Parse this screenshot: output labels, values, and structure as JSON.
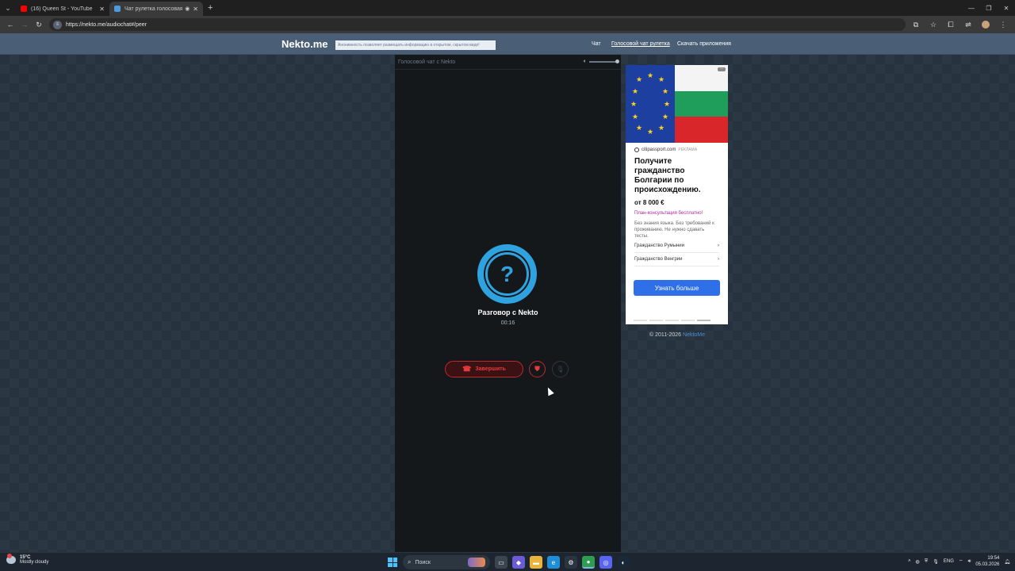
{
  "browser": {
    "tabs": [
      {
        "title": "(16) Queen St - YouTube",
        "icon": "youtube-icon",
        "color": "#ff0000",
        "active": false
      },
      {
        "title": "Чат рулетка голосовая — ",
        "icon": "nekto-favicon",
        "color": "#4a9be0",
        "active": true
      }
    ],
    "new_tab": "+",
    "url": "https://nekto.me/audiochat#/peer"
  },
  "site": {
    "logo": "Nekto.me",
    "banner": "Анонимность позволяет размещать информацию в открытом, скрытом виде!",
    "nav": [
      {
        "label": "Чат",
        "active": false
      },
      {
        "label": "Голосовой чат рулетка",
        "active": true
      },
      {
        "label": "Скачать приложения",
        "active": false
      }
    ]
  },
  "chat": {
    "header": "Голосовой чат с Nekto",
    "avatar_symbol": "?",
    "peer_name": "Разговор с Nekto",
    "timer": "00:16",
    "end_label": "Завершить",
    "volume_level": 1.0
  },
  "ad": {
    "source": "citipassport.com",
    "tag": "РЕКЛАМА",
    "title": "Получите гражданство Болгарии по происхождению.",
    "price": "от 8 000 €",
    "promo": "План-консультация бесплатно!",
    "description": "Без знания языка. Без требований к проживанию. Не нужно сдавать тесты.",
    "links": [
      "Гражданство Румынии",
      "Гражданство Венгрии"
    ],
    "cta": "Узнать больше",
    "more": "···"
  },
  "footer": {
    "copyright": "© 2011-2026",
    "brand_link": "NektoMe"
  },
  "taskbar": {
    "weather_temp": "15°C",
    "weather_desc": "Mostly cloudy",
    "search_placeholder": "Поиск",
    "lang": "ENG",
    "time": "19:54",
    "date": "05.03.2026"
  },
  "colors": {
    "accent": "#2ea3e0",
    "danger": "#e53a3f",
    "header": "#4a5f76",
    "ad_cta": "#2f6fe8"
  }
}
